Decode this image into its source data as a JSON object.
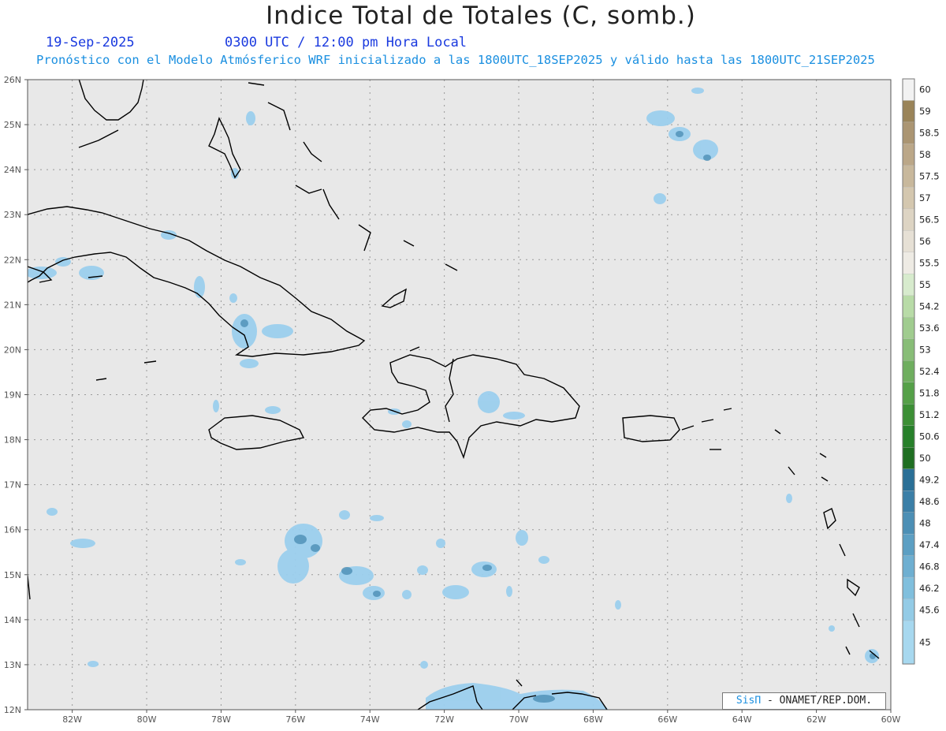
{
  "header": {
    "title": "Indice Total de Totales (C, somb.)",
    "date": "19-Sep-2025",
    "time": "0300 UTC / 12:00 pm Hora Local",
    "forecast": "Pronóstico con el Modelo Atmósferico WRF inicializado a las 1800UTC_18SEP2025 y válido hasta las  1800UTC_21SEP2025"
  },
  "map": {
    "lat_labels": [
      "26N",
      "25N",
      "24N",
      "23N",
      "22N",
      "21N",
      "20N",
      "19N",
      "18N",
      "17N",
      "16N",
      "15N",
      "14N",
      "13N",
      "12N"
    ],
    "lon_labels": [
      "82W",
      "80W",
      "78W",
      "76W",
      "74W",
      "72W",
      "70W",
      "68W",
      "66W",
      "64W",
      "62W",
      "60W"
    ],
    "lat_range": [
      12,
      26
    ],
    "lon_range": [
      -83.2,
      -60
    ],
    "background_color": "#e8e8e8",
    "grid": "dotted"
  },
  "colorbar": {
    "labels": [
      "60",
      "59",
      "58.5",
      "58",
      "57.5",
      "57",
      "56.5",
      "56",
      "55.5",
      "55",
      "54.2",
      "53.6",
      "53",
      "52.4",
      "51.8",
      "51.2",
      "50.6",
      "50",
      "49.2",
      "48.6",
      "48",
      "47.4",
      "46.8",
      "46.2",
      "45.6",
      "45"
    ],
    "colors": [
      "#f2f2f2",
      "#9a8459",
      "#ab9572",
      "#bba788",
      "#c8b89c",
      "#d4c7af",
      "#ddd4c3",
      "#e6e0d5",
      "#eeebe4",
      "#d7ebcd",
      "#b8dba7",
      "#a0cc8f",
      "#88bd77",
      "#6fae5f",
      "#55a048",
      "#3c8f35",
      "#27802a",
      "#1f6f22",
      "#2a6f96",
      "#3b7fa7",
      "#4c8fb5",
      "#5c9fc3",
      "#6eafd1",
      "#80bfdd",
      "#93cbe6",
      "#a7d8ef"
    ]
  },
  "credit": {
    "brand": "SisΠ",
    "text": " - ONAMET/REP.DOM."
  }
}
